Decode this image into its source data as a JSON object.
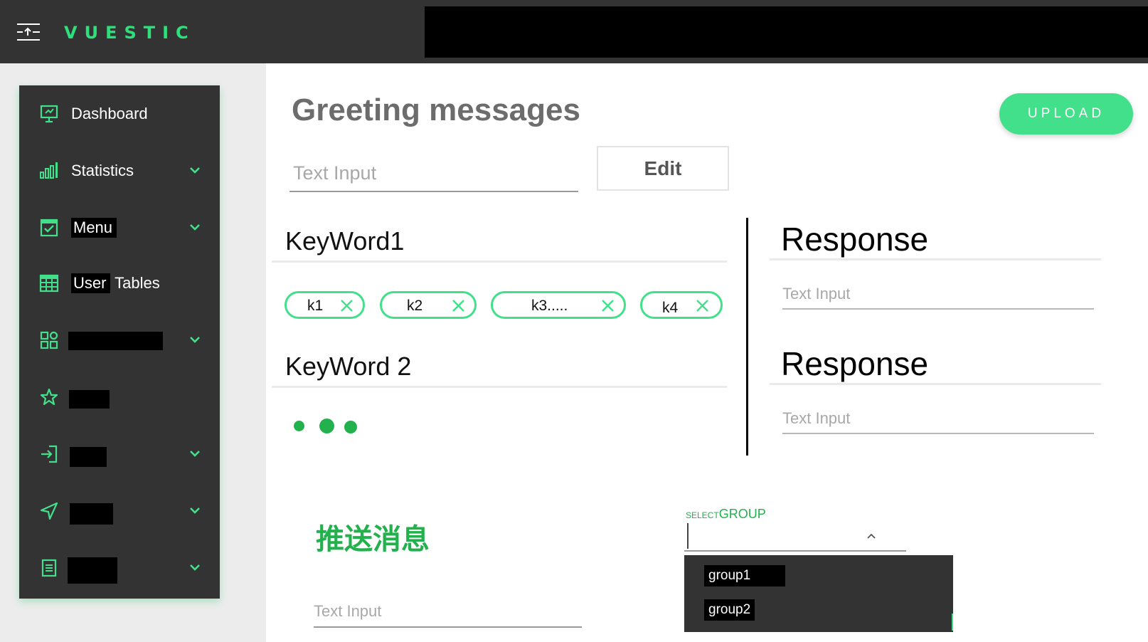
{
  "header": {
    "logo_text": "VUESTIC",
    "menu_toggle_icon": "menu-collapse-icon",
    "accent_color": "#2ee07b"
  },
  "sidebar": {
    "items": [
      {
        "label": "Dashboard",
        "icon": "monitor-icon",
        "expandable": false
      },
      {
        "label": "Statistics",
        "icon": "bar-chart-icon",
        "expandable": true
      },
      {
        "label": "Menu",
        "icon": "checkbox-icon",
        "expandable": true
      },
      {
        "label_a": "User",
        "label_b": "Tables",
        "icon": "table-icon",
        "expandable": false
      },
      {
        "label": "",
        "icon": "apps-icon",
        "expandable": true
      },
      {
        "label": "",
        "icon": "star-icon",
        "expandable": false
      },
      {
        "label": "",
        "icon": "login-icon",
        "expandable": true
      },
      {
        "label": "",
        "icon": "send-icon",
        "expandable": true
      },
      {
        "label": "",
        "icon": "document-icon",
        "expandable": true
      }
    ]
  },
  "main": {
    "title": "Greeting messages",
    "upload_label": "UPLOAD",
    "title_input_placeholder": "Text Input",
    "edit_label": "Edit",
    "keywords": [
      {
        "title": "KeyWord1",
        "chips": [
          "k1",
          "k2",
          "k3.....",
          "k4"
        ],
        "response_title": "Response",
        "response_placeholder": "Text Input"
      },
      {
        "title": "KeyWord 2",
        "chips": [],
        "loading": true,
        "response_title": "Response",
        "response_placeholder": "Text Input"
      }
    ],
    "push": {
      "title": "推送消息",
      "input_placeholder": "Text Input"
    },
    "select_group": {
      "label_small": "SELECT",
      "label_large": "GROUP",
      "value": "",
      "options": [
        "group1",
        "group2"
      ]
    }
  },
  "colors": {
    "brand_green": "#42e08a",
    "dark_green": "#22b14c",
    "sidebar_bg": "#333333"
  }
}
